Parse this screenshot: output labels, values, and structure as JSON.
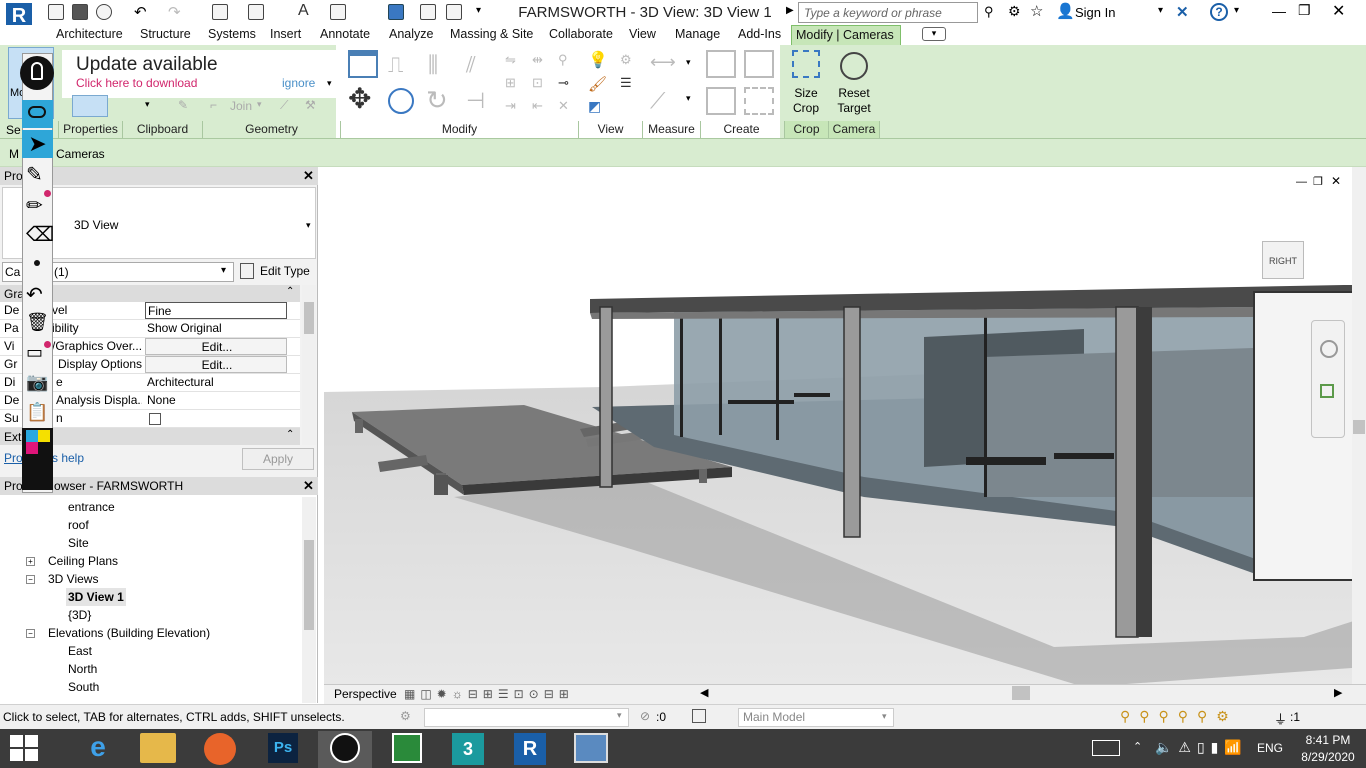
{
  "app": {
    "title": "FARMSWORTH - 3D View: 3D View 1",
    "search_placeholder": "Type a keyword or phrase",
    "sign_in": "Sign In",
    "logo_letter": "R"
  },
  "ribbon_tabs": [
    "Architecture",
    "Structure",
    "Systems",
    "Insert",
    "Annotate",
    "Analyze",
    "Massing & Site",
    "Collaborate",
    "View",
    "Manage",
    "Add-Ins",
    "Modify | Cameras"
  ],
  "update": {
    "title": "Update available",
    "link": "Click here to download",
    "ignore": "ignore"
  },
  "ribbon": {
    "modify_label": "Modify",
    "select_label": "Se",
    "join_label": "Join",
    "size_crop": "Size\nCrop",
    "reset_target": "Reset\nTarget",
    "size_crop_l1": "Size",
    "size_crop_l2": "Crop",
    "reset_l1": "Reset",
    "reset_l2": "Target",
    "panels": [
      "Properties",
      "Clipboard",
      "Geometry",
      "Modify",
      "View",
      "Measure",
      "Create",
      "Crop",
      "Camera"
    ]
  },
  "optionsbar": {
    "context_prefix": "M",
    "context": "Cameras"
  },
  "properties": {
    "title_prefix": "Pro",
    "type_name": "3D View",
    "category_prefix": "Ca",
    "category": "(1)",
    "edit_type": "Edit Type",
    "section_graphics": "Gra",
    "rows": [
      {
        "k1": "De",
        "k2": "vel",
        "value": "Fine"
      },
      {
        "k1": "Pa",
        "k2": "ibility",
        "value": "Show Original"
      },
      {
        "k1": "Vi",
        "k2": "/Graphics Over...",
        "value": "Edit..."
      },
      {
        "k1": "Gr",
        "k2": "Display Options",
        "value": "Edit..."
      },
      {
        "k1": "Di",
        "k2": "e",
        "value": "Architectural"
      },
      {
        "k1": "De",
        "k2": "Analysis Displa...",
        "value": "None"
      },
      {
        "k1": "Su",
        "k2": "n",
        "value": ""
      }
    ],
    "section_extents": "Ext",
    "help_prefix": "Pro",
    "help": "s help",
    "apply": "Apply"
  },
  "browser": {
    "title_prefix": "Pro",
    "title": "owser - FARMSWORTH",
    "items": [
      {
        "label": "entrance",
        "level": 3
      },
      {
        "label": "roof",
        "level": 3
      },
      {
        "label": "Site",
        "level": 3
      },
      {
        "label": "Ceiling Plans",
        "level": 1,
        "expander": "+"
      },
      {
        "label": "3D Views",
        "level": 1,
        "expander": "−"
      },
      {
        "label": "3D View 1",
        "level": 3,
        "selected": true
      },
      {
        "label": "{3D}",
        "level": 3
      },
      {
        "label": "Elevations (Building Elevation)",
        "level": 1,
        "expander": "−"
      },
      {
        "label": "East",
        "level": 3
      },
      {
        "label": "North",
        "level": 3
      },
      {
        "label": "South",
        "level": 3
      }
    ]
  },
  "viewport": {
    "viewcube_face": "RIGHT",
    "mode": "Perspective"
  },
  "status": {
    "hint": "Click to select, TAB for alternates, CTRL adds, SHIFT unselects.",
    "count": ":0",
    "model": "Main Model",
    "filter": ":1"
  },
  "tray": {
    "lang": "ENG",
    "time": "8:41 PM",
    "date": "8/29/2020"
  },
  "colors": {
    "ribbon_bg": "#d8ecd0",
    "active_tab": "#c7e6b8",
    "taskbar": "#3b3b3b",
    "accent_blue": "#1a5fa8",
    "update_link": "#d1266c"
  }
}
